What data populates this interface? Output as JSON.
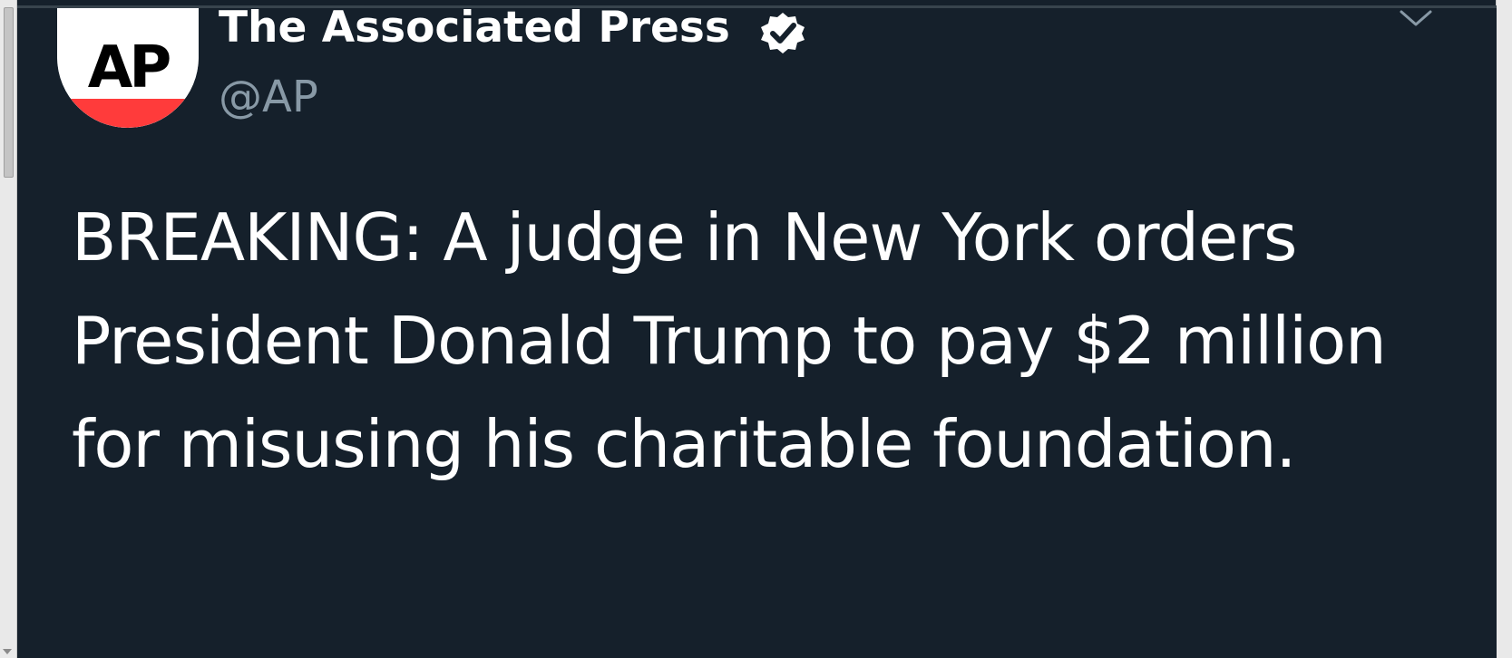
{
  "tweet": {
    "author": {
      "display_name": "The Associated Press",
      "handle": "@AP",
      "verified": true,
      "avatar_logo_text": "AP"
    },
    "text": "BREAKING: A judge in New York orders President Donald Trump to pay $2 million for misusing his charitable foundation."
  },
  "icons": {
    "verified_badge": "verified-badge-icon",
    "more_menu": "chevron-down-icon"
  },
  "colors": {
    "background": "#15202b",
    "text_primary": "#ffffff",
    "text_secondary": "#8899a6",
    "avatar_accent": "#ff3b3b"
  }
}
